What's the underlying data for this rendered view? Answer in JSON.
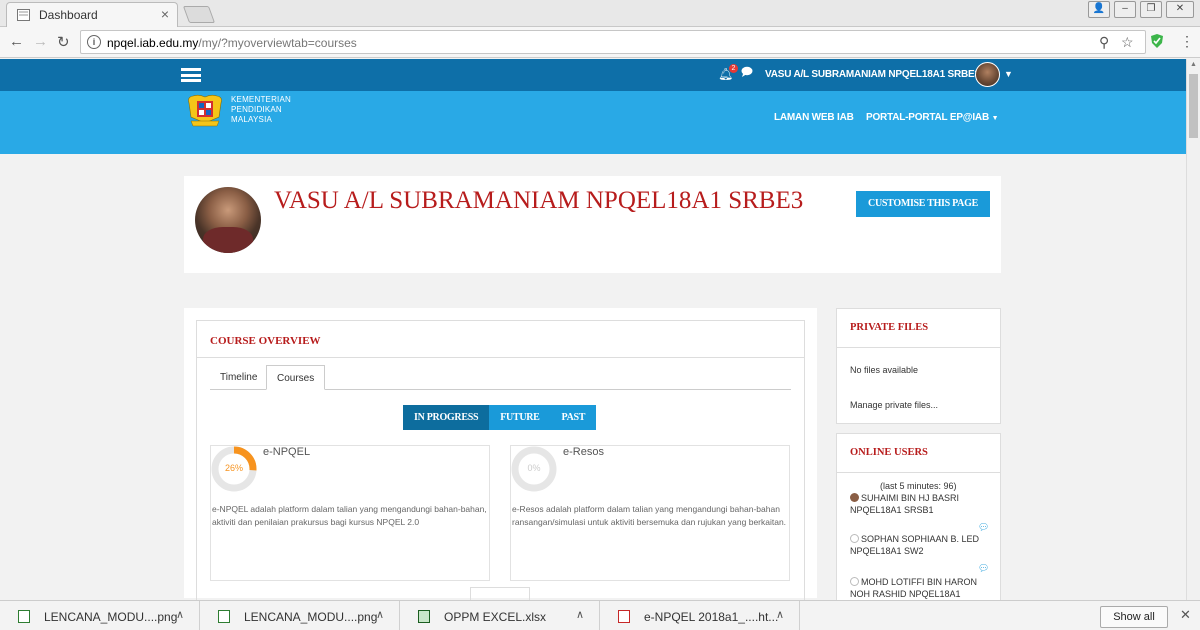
{
  "browser": {
    "tab_title": "Dashboard",
    "tab_close": "×",
    "url_host": "npqel.iab.edu.my",
    "url_path": "/my/?myoverviewtab=courses"
  },
  "header": {
    "notification_count": "2",
    "username": "VASU A/L SUBRAMANIAM NPQEL18A1 SRBE3",
    "logo_line1": "KEMENTERIAN",
    "logo_line2": "PENDIDIKAN",
    "logo_line3": "MALAYSIA",
    "nav_laman": "LAMAN WEB IAB",
    "nav_portal": "PORTAL-PORTAL EP@IAB"
  },
  "profile": {
    "name": "VASU A/L SUBRAMANIAM NPQEL18A1 SRBE3",
    "customise_label": "CUSTOMISE THIS PAGE"
  },
  "overview": {
    "title": "COURSE OVERVIEW",
    "tabs": [
      "Timeline",
      "Courses"
    ],
    "segments": [
      "IN PROGRESS",
      "FUTURE",
      "PAST"
    ],
    "courses": [
      {
        "title": "e-NPQEL",
        "progress_label": "26%",
        "progress": 26,
        "description": "e-NPQEL adalah platform dalam talian yang mengandungi bahan-bahan, aktiviti dan penilaian prakursus bagi kursus NPQEL 2.0"
      },
      {
        "title": "e-Resos",
        "progress_label": "0%",
        "progress": 0,
        "description": "e-Resos adalah platform dalam talian yang mengandungi bahan-bahan ransangan/simulasi untuk aktiviti bersemuka dan rujukan yang berkaitan."
      }
    ]
  },
  "private_files": {
    "title": "PRIVATE FILES",
    "empty_text": "No files available",
    "manage_link": "Manage private files..."
  },
  "online_users": {
    "title": "ONLINE USERS",
    "subtitle": "(last 5 minutes: 96)",
    "users": [
      "SUHAIMI BIN HJ BASRI NPQEL18A1 SRSB1",
      "SOPHAN SOPHIAAN B. LED NPQEL18A1 SW2",
      "MOHD LOTIFFI BIN HARON NOH RASHID NPQEL18A1"
    ]
  },
  "downloads": {
    "items": [
      "LENCANA_MODU....png",
      "LENCANA_MODU....png",
      "OPPM EXCEL.xlsx",
      "e-NPQEL 2018a1_....ht..."
    ],
    "show_all": "Show all"
  },
  "colors": {
    "topnav": "#0e6fa8",
    "banner": "#29a9e6",
    "accent": "#1a9ad9",
    "title_red": "#b71c1c",
    "progress_orange": "#f7931e"
  }
}
